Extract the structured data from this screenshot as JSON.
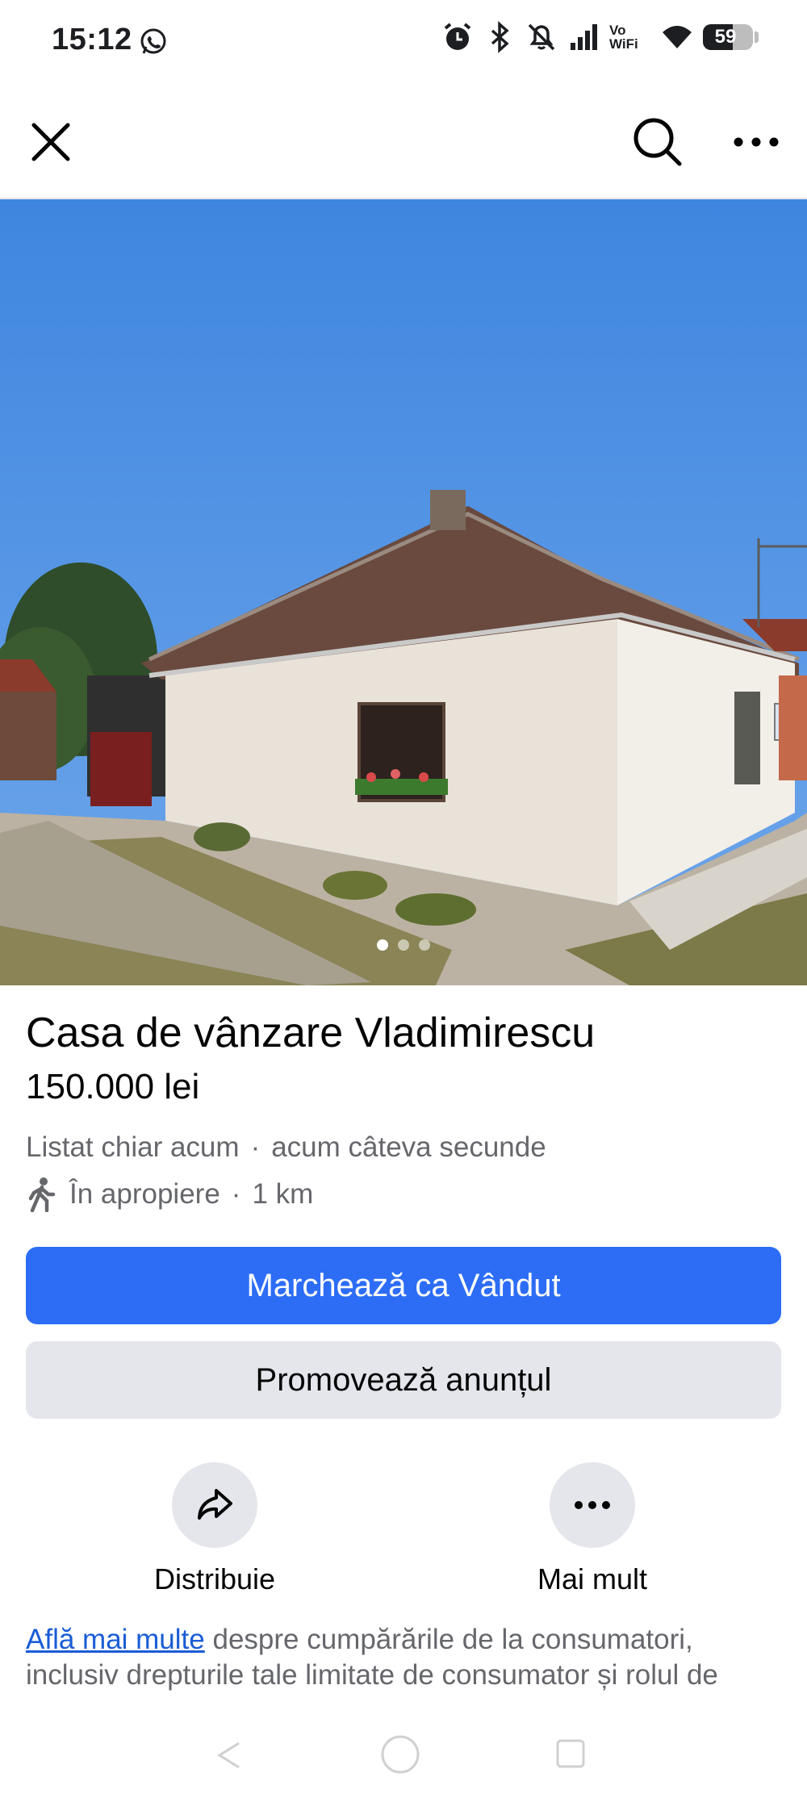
{
  "status_bar": {
    "time": "15:12",
    "vowifi_top": "Vo",
    "vowifi_bottom": "WiFi",
    "battery": "59",
    "battery_level": 0.59,
    "icons": [
      "whatsapp-icon",
      "alarm-icon",
      "bluetooth-icon",
      "bell-muted-icon",
      "signal-icon",
      "vowifi-icon",
      "wifi-icon",
      "battery-icon"
    ]
  },
  "top_bar": {
    "icons": [
      "close-icon",
      "search-icon",
      "more-icon"
    ]
  },
  "gallery": {
    "image_count": 3,
    "active_index": 0
  },
  "listing": {
    "title": "Casa de vânzare Vladimirescu",
    "price": "150.000 lei",
    "listed": "Listat chiar acum",
    "time_ago": "acum câteva secunde",
    "location": "În apropiere",
    "distance": "1 km",
    "separator": "·"
  },
  "buttons": {
    "mark_sold": "Marchează ca Vândut",
    "promote": "Promovează anunțul"
  },
  "actions": {
    "share": "Distribuie",
    "more": "Mai mult"
  },
  "legal": {
    "link": "Află mai multe",
    "text": " despre cumpărările de la consumatori, inclusiv drepturile tale limitate de consumator și rolul de"
  },
  "colors": {
    "primary": "#2d6df6",
    "secondary_bg": "#e4e6eb",
    "secondary_text": "#65676b",
    "link": "#1a5cd6"
  }
}
